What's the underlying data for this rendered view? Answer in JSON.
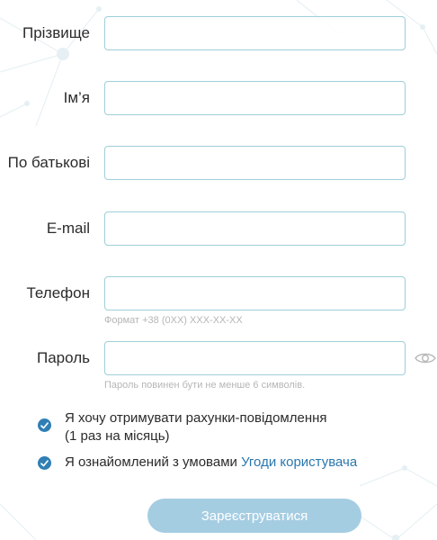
{
  "form": {
    "fields": [
      {
        "label": "Прізвище",
        "value": ""
      },
      {
        "label": "Ім’я",
        "value": ""
      },
      {
        "label": "По батькові",
        "value": ""
      },
      {
        "label": "E-mail",
        "value": ""
      },
      {
        "label": "Телефон",
        "value": "",
        "hint": "Формат +38 (0XX) XXX-XX-XX"
      },
      {
        "label": "Пароль",
        "value": "",
        "hint": "Пароль повинен бути не менше 6 символів."
      }
    ],
    "checkboxes": [
      {
        "line1": "Я хочу отримувати рахунки-повідомлення",
        "line2": "(1 раз на місяць)",
        "checked": true
      },
      {
        "text": "Я ознайомлений з умовами ",
        "link": "Угоди користувача",
        "checked": true
      }
    ],
    "submit_label": "Зареєструватися"
  },
  "colors": {
    "field_border": "#9ecfd9",
    "checkbox": "#2f7fb5",
    "link": "#2a77ad",
    "button": "#a5cde2"
  },
  "icons": {
    "password_toggle": "eye-icon",
    "checkbox_mark": "checkmark-icon"
  }
}
